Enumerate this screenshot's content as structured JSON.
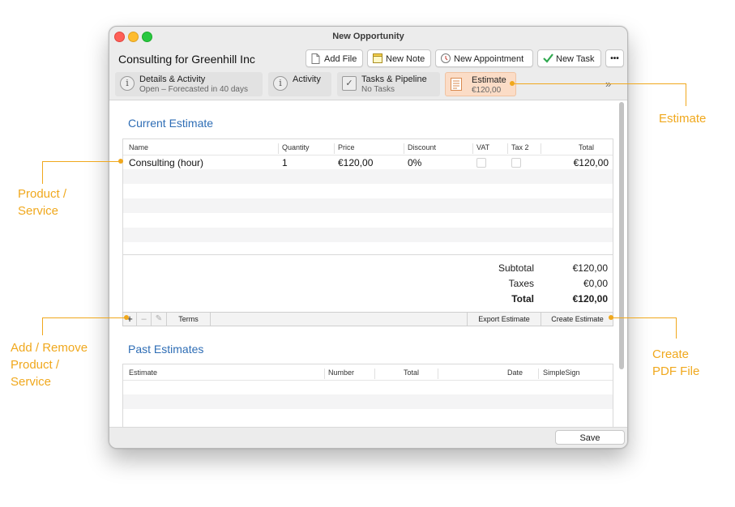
{
  "window": {
    "title": "New Opportunity"
  },
  "header": {
    "title": "Consulting for Greenhill Inc"
  },
  "toolbar": {
    "add_file": "Add File",
    "new_note": "New Note",
    "new_appointment": "New Appointment",
    "new_task": "New Task",
    "more": "•••"
  },
  "tabs": [
    {
      "label": "Details & Activity",
      "sub": "Open – Forecasted in 40 days"
    },
    {
      "label": "Activity",
      "sub": ""
    },
    {
      "label": "Tasks & Pipeline",
      "sub": "No Tasks"
    },
    {
      "label": "Estimate",
      "sub": "€120,00"
    }
  ],
  "tabs_more": "»",
  "current_estimate": {
    "title": "Current Estimate",
    "columns": [
      "Name",
      "Quantity",
      "Price",
      "Discount",
      "VAT",
      "Tax 2",
      "Total"
    ],
    "rows": [
      {
        "name": "Consulting (hour)",
        "quantity": "1",
        "price": "€120,00",
        "discount": "0%",
        "vat": false,
        "tax2": false,
        "total": "€120,00"
      }
    ],
    "subtotal_label": "Subtotal",
    "subtotal": "€120,00",
    "taxes_label": "Taxes",
    "taxes": "€0,00",
    "total_label": "Total",
    "total": "€120,00"
  },
  "bottom_bar": {
    "add": "+",
    "remove": "–",
    "edit": "✎",
    "terms": "Terms",
    "export": "Export Estimate",
    "create": "Create Estimate"
  },
  "past_estimates": {
    "title": "Past Estimates",
    "columns": [
      "Estimate",
      "Number",
      "Total",
      "Date",
      "SimpleSign"
    ]
  },
  "footer": {
    "save": "Save"
  },
  "annotations": {
    "estimate": "Estimate",
    "product_l1": "Product /",
    "product_l2": "Service",
    "add_l1": "Add / Remove",
    "add_l2": "Product /",
    "add_l3": "Service",
    "create_l1": "Create",
    "create_l2": "PDF File"
  },
  "colors": {
    "accent": "#f0a81d",
    "section_title": "#2e6db5",
    "active_tab": "#fbdcc6"
  }
}
